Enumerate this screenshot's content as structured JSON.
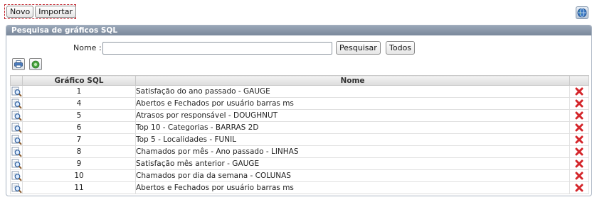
{
  "toolbar": {
    "new_label": "Novo",
    "import_label": "Importar"
  },
  "panel": {
    "title": "Pesquisa de gráficos SQL"
  },
  "search": {
    "name_label": "Nome :",
    "name_value": "",
    "search_button": "Pesquisar",
    "all_button": "Todos"
  },
  "table": {
    "columns": [
      "Gráfico SQL",
      "Nome"
    ],
    "rows": [
      {
        "id": "1",
        "name": "Satisfação do ano passado - GAUGE"
      },
      {
        "id": "4",
        "name": "Abertos e Fechados por usuário barras ms"
      },
      {
        "id": "5",
        "name": "Atrasos por responsável - DOUGHNUT"
      },
      {
        "id": "6",
        "name": "Top 10 - Categorias - BARRAS 2D"
      },
      {
        "id": "7",
        "name": "Top 5 - Localidades - FUNIL"
      },
      {
        "id": "8",
        "name": "Chamados por mês - Ano passado - LINHAS"
      },
      {
        "id": "9",
        "name": "Satisfação mês anterior - GAUGE"
      },
      {
        "id": "10",
        "name": "Chamados por dia da semana - COLUNAS"
      },
      {
        "id": "11",
        "name": "Abertos e Fechados por usuário barras ms"
      }
    ]
  },
  "icons": {
    "globe": "globe-icon",
    "print": "print-icon",
    "refresh": "refresh-icon",
    "view": "magnifier-icon",
    "delete": "delete-x-icon"
  },
  "colors": {
    "header_bg": "#7a889b",
    "delete_red": "#d4262b",
    "toolbar_border": "#c0202a"
  }
}
